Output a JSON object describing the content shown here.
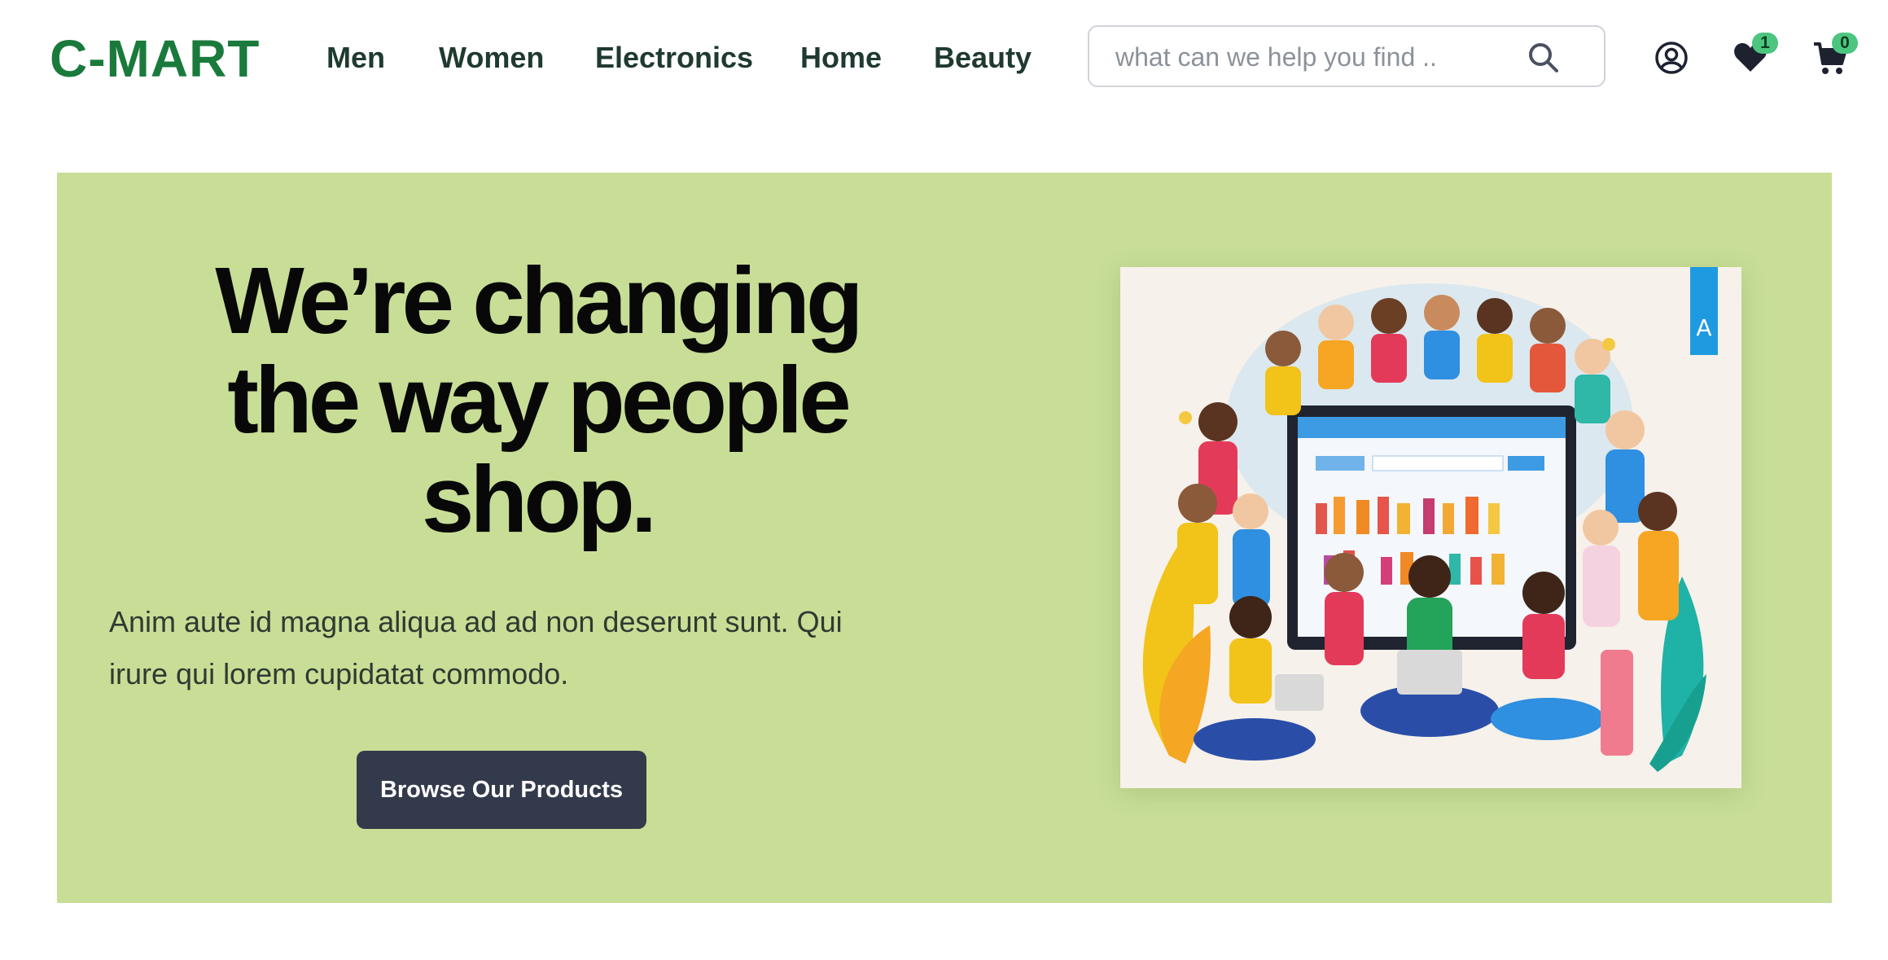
{
  "brand": {
    "name": "C-MART",
    "color": "#1a7a3c"
  },
  "nav": [
    {
      "label": "Men"
    },
    {
      "label": "Women"
    },
    {
      "label": "Electronics"
    },
    {
      "label": "Home"
    },
    {
      "label": "Beauty"
    }
  ],
  "search": {
    "placeholder": "what can we help you find ..",
    "value": ""
  },
  "header_icons": {
    "account": "user-circle-icon",
    "wishlist": {
      "icon": "heart-icon",
      "count": "1"
    },
    "cart": {
      "icon": "cart-icon",
      "count": "0"
    }
  },
  "hero": {
    "line1": "We’re changing",
    "line2": "the way people",
    "line3": "shop.",
    "description": "Anim aute id magna aliqua ad ad non deserunt sunt. Qui irure qui lorem cupidatat commodo.",
    "cta_label": "Browse Our Products",
    "background": "#c8de96",
    "image": "online-shopping-crowd-illustration"
  }
}
